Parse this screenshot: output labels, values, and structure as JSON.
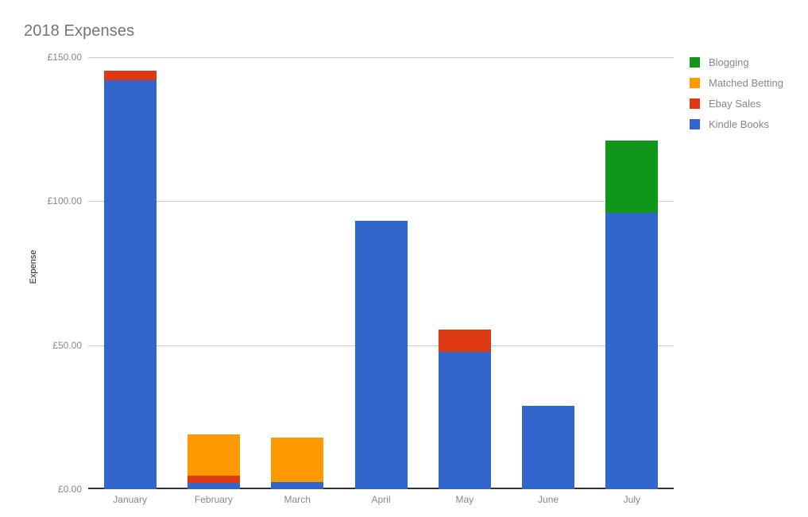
{
  "chart_data": {
    "type": "bar",
    "subtype": "stacked-column",
    "title": "2018 Expenses",
    "xlabel": "",
    "ylabel": "Expense",
    "categories": [
      "January",
      "February",
      "March",
      "April",
      "May",
      "June",
      "July"
    ],
    "ylim": [
      0,
      150
    ],
    "y_ticks": [
      0,
      50,
      100,
      150
    ],
    "y_tick_labels": [
      "£0.00",
      "£50.00",
      "£100.00",
      "£150.00"
    ],
    "currency_symbol": "£",
    "grid": true,
    "legend_position": "right",
    "stack_order_bottom_to_top": [
      "Kindle Books",
      "Ebay Sales",
      "Matched Betting",
      "Blogging"
    ],
    "series": [
      {
        "name": "Blogging",
        "color": "#109618",
        "values": [
          0,
          0,
          0,
          0,
          0,
          0,
          25.0
        ]
      },
      {
        "name": "Matched Betting",
        "color": "#ff9900",
        "values": [
          0,
          14.3,
          15.5,
          0,
          0,
          0,
          0
        ]
      },
      {
        "name": "Ebay Sales",
        "color": "#dc3912",
        "values": [
          3.3,
          2.5,
          0,
          0,
          7.7,
          0,
          0
        ]
      },
      {
        "name": "Kindle Books",
        "color": "#3366cc",
        "values": [
          142.0,
          2.2,
          2.5,
          93.2,
          47.7,
          29.0,
          96.0
        ]
      }
    ],
    "totals": [
      145.3,
      19.0,
      18.0,
      93.2,
      55.4,
      29.0,
      121.0
    ]
  },
  "legend": {
    "items": [
      {
        "label": "Blogging",
        "color": "#109618"
      },
      {
        "label": "Matched Betting",
        "color": "#ff9900"
      },
      {
        "label": "Ebay Sales",
        "color": "#dc3912"
      },
      {
        "label": "Kindle Books",
        "color": "#3366cc"
      }
    ]
  },
  "colors": {
    "background": "#ffffff",
    "title_text": "#757575",
    "axis_text": "#888888",
    "gridline": "#cccccc",
    "baseline": "#333333",
    "axis_title_text": "#222222"
  }
}
